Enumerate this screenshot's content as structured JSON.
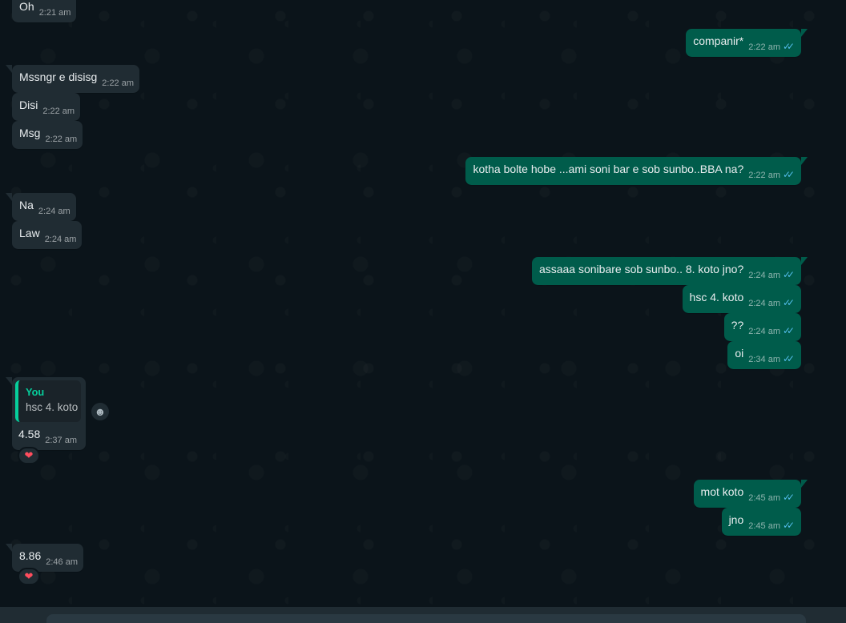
{
  "colors": {
    "background": "#0b141a",
    "incoming_bubble": "#202c33",
    "outgoing_bubble": "#005c4b",
    "read_ticks": "#53bdeb",
    "quote_accent": "#06cf9c"
  },
  "ticks_glyph": "✓✓",
  "messages": [
    {
      "text": "Oh",
      "time": "2:21 am"
    },
    {
      "text": "companir*",
      "time": "2:22 am"
    },
    {
      "text": "Mssngr e disisg",
      "time": "2:22 am"
    },
    {
      "text": "Disi",
      "time": "2:22 am"
    },
    {
      "text": "Msg",
      "time": "2:22 am"
    },
    {
      "text": "kotha bolte hobe ...ami soni bar e sob sunbo..BBA na?",
      "time": "2:22 am"
    },
    {
      "text": "Na",
      "time": "2:24 am"
    },
    {
      "text": "Law",
      "time": "2:24 am"
    },
    {
      "text": "assaaa sonibare sob sunbo.. 8. koto jno?",
      "time": "2:24 am"
    },
    {
      "text": "hsc 4. koto",
      "time": "2:24 am"
    },
    {
      "text": "??",
      "time": "2:24 am"
    },
    {
      "text": "oi",
      "time": "2:34 am"
    },
    {
      "text": "4.58",
      "time": "2:37 am",
      "quote_author": "You",
      "quote_text": "hsc 4. koto",
      "reaction": "❤"
    },
    {
      "text": "mot koto",
      "time": "2:45 am"
    },
    {
      "text": "jno",
      "time": "2:45 am"
    },
    {
      "text": "8.86",
      "time": "2:46 am",
      "reaction": "❤"
    }
  ],
  "emoji_button_glyph": "☻"
}
